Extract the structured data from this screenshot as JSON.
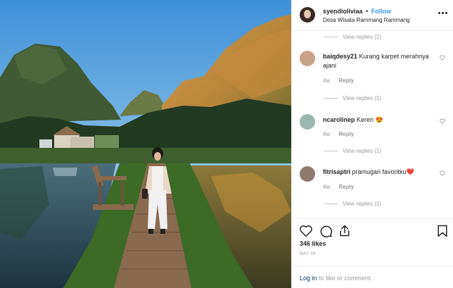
{
  "post": {
    "username": "syendioliviaa",
    "separator": "•",
    "follow_label": "Follow",
    "location": "Desa Wisata Rammang Rammang"
  },
  "comments": {
    "view_replies_1": "View replies (1)",
    "items": [
      {
        "username": "baiqdesy21",
        "text": "Kurang karpet merahnya ajani",
        "age": "4w",
        "reply_label": "Reply",
        "view_replies": "View replies (1)",
        "avatar_color": "#c9a38a"
      },
      {
        "username": "ncarolinep",
        "text": "Keren 😍",
        "age": "4w",
        "reply_label": "Reply",
        "view_replies": "View replies (1)",
        "avatar_color": "#9bb7b0"
      },
      {
        "username": "fitrisaptri",
        "text": "pramugari favoritku❤️",
        "age": "4w",
        "reply_label": "Reply",
        "view_replies": "View replies (1)",
        "avatar_color": "#8c7a6f"
      }
    ]
  },
  "actions": {
    "icons": [
      "heart-icon",
      "comment-icon",
      "share-icon",
      "bookmark-icon"
    ],
    "likes": "346 likes",
    "date": "MAY 19"
  },
  "login_bar": {
    "login_label": "Log in",
    "suffix": " to like or comment."
  },
  "colors": {
    "link_blue": "#3897f0",
    "muted": "#999999",
    "login_blue": "#003569"
  }
}
